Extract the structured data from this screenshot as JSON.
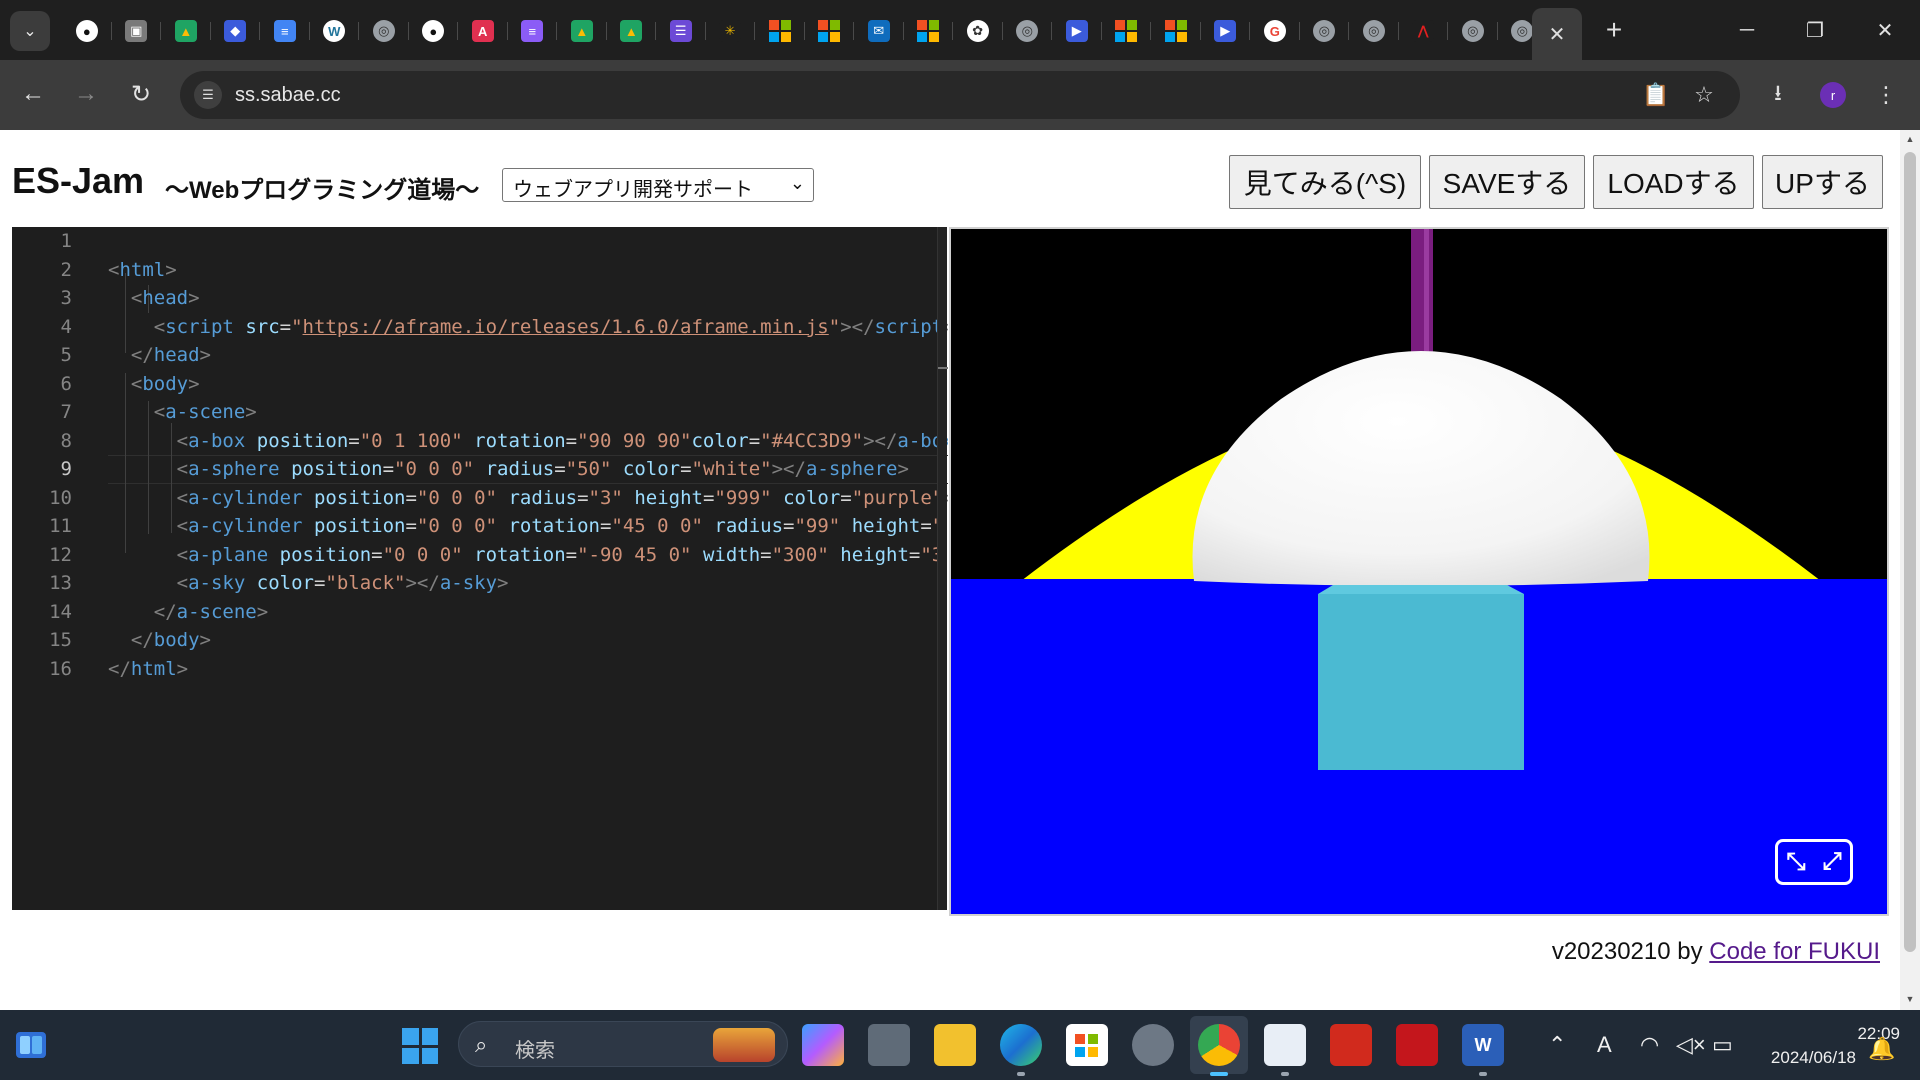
{
  "browser": {
    "active_tab_close": "✕",
    "new_tab": "+",
    "url": "ss.sabae.cc",
    "window_controls": {
      "minimize": "─",
      "restore": "❐",
      "close": "✕"
    },
    "profile_initial": "r"
  },
  "page": {
    "title": "ES-Jam",
    "subtitle": "～Webプログラミング道場～",
    "mode_select": {
      "selected": "ウェブアプリ開発サポート"
    },
    "buttons": {
      "run": "見てみる(^S)",
      "save": "SAVEする",
      "load": "LOADする",
      "upload": "UPする"
    },
    "footer": {
      "version": "v20230210 by ",
      "link": "Code for FUKUI"
    }
  },
  "editor": {
    "current_line": 9,
    "line_numbers": [
      "1",
      "2",
      "3",
      "4",
      "5",
      "6",
      "7",
      "8",
      "9",
      "10",
      "11",
      "12",
      "13",
      "14",
      "15",
      "16"
    ]
  },
  "taskbar": {
    "search_label": "検索",
    "time": "22:09",
    "date": "2024/06/18",
    "ime_indicator": "A"
  }
}
